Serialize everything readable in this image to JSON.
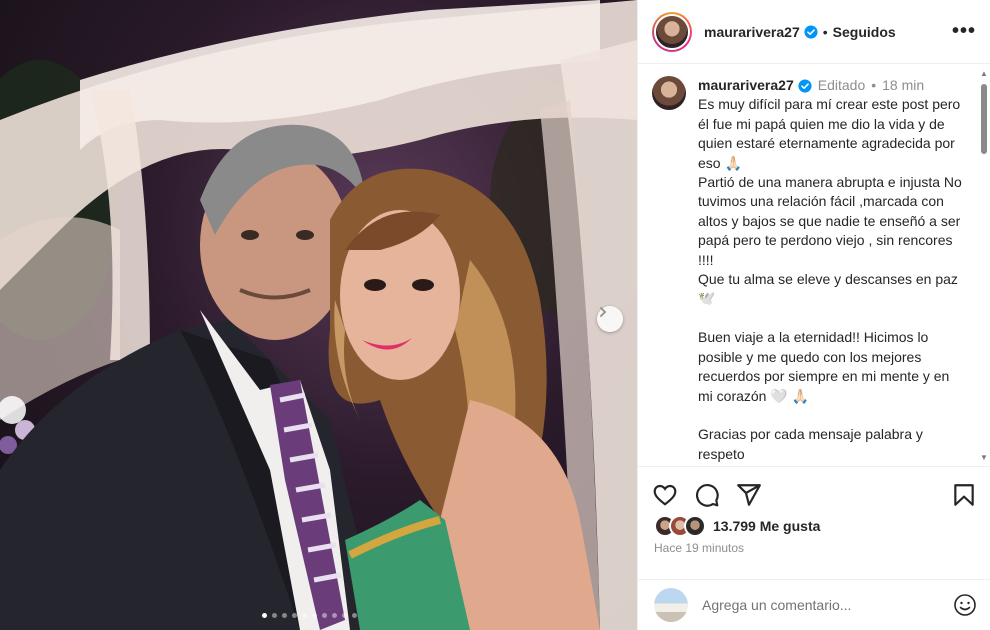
{
  "post": {
    "username": "maurarivera27",
    "follow_status": "Seguidos",
    "separator": "•",
    "more_icon": "more-horizontal-icon",
    "media": {
      "slide_count": 10,
      "active_slide": 1,
      "next_icon": "chevron-right-icon"
    }
  },
  "caption": {
    "username": "maurarivera27",
    "edited_label": "Editado",
    "separator": "•",
    "time": "18 min",
    "text": "Es muy difícil para mí crear este post pero él fue mi papá quien me dio la vida y de quien estaré eternamente agradecida por eso 🙏🏻\nPartió de una manera abrupta e injusta No tuvimos una relación fácil ,marcada con altos y bajos se que nadie te enseñó a ser papá pero te perdono viejo , sin rencores !!!!\nQue tu alma se eleve y descanses en paz 🕊️\n\nBuen viaje a la eternidad!! Hicimos lo posible y me quedo con los mejores recuerdos por siempre en mi mente y en mi corazón 🤍 🙏🏻\n\nGracias por cada mensaje palabra y respeto"
  },
  "actions": {
    "like_icon": "heart-icon",
    "comment_icon": "comment-icon",
    "share_icon": "share-icon",
    "save_icon": "bookmark-icon"
  },
  "likes": {
    "label": "13.799 Me gusta"
  },
  "timestamp": "Hace 19 minutos",
  "comment_box": {
    "placeholder": "Agrega un comentario...",
    "emoji_icon": "emoji-icon"
  },
  "colors": {
    "verified": "#0095f6",
    "text": "#262626",
    "secondary": "#8e8e8e",
    "border": "#efefef"
  }
}
